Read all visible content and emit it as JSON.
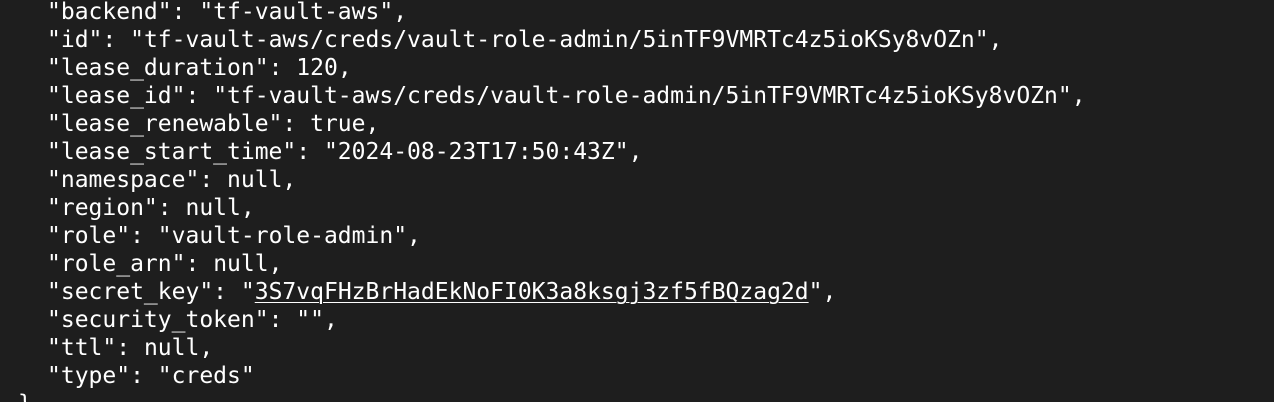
{
  "terminal": {
    "lines": [
      {
        "key": "\"backend\"",
        "sep": ": ",
        "value": "\"tf-vault-aws\"",
        "end": ","
      },
      {
        "key": "\"id\"",
        "sep": ": ",
        "value": "\"tf-vault-aws/creds/vault-role-admin/5inTF9VMRTc4z5ioKSy8vOZn\"",
        "end": ","
      },
      {
        "key": "\"lease_duration\"",
        "sep": ": ",
        "value": "120",
        "end": ","
      },
      {
        "key": "\"lease_id\"",
        "sep": ": ",
        "value": "\"tf-vault-aws/creds/vault-role-admin/5inTF9VMRTc4z5ioKSy8vOZn\"",
        "end": ","
      },
      {
        "key": "\"lease_renewable\"",
        "sep": ": ",
        "value": "true",
        "end": ","
      },
      {
        "key": "\"lease_start_time\"",
        "sep": ": ",
        "value": "\"2024-08-23T17:50:43Z\"",
        "end": ","
      },
      {
        "key": "\"namespace\"",
        "sep": ": ",
        "value": "null",
        "end": ","
      },
      {
        "key": "\"region\"",
        "sep": ": ",
        "value": "null",
        "end": ","
      },
      {
        "key": "\"role\"",
        "sep": ": ",
        "value": "\"vault-role-admin\"",
        "end": ","
      },
      {
        "key": "\"role_arn\"",
        "sep": ": ",
        "value": "null",
        "end": ","
      },
      {
        "key": "\"secret_key\"",
        "sep": ": ",
        "value_open": "\"",
        "value_link": "3S7vqFHzBrHadEkNoFI0K3a8ksgj3zf5fBQzag2d",
        "value_close": "\"",
        "end": ","
      },
      {
        "key": "\"security_token\"",
        "sep": ": ",
        "value": "\"\"",
        "end": ","
      },
      {
        "key": "\"ttl\"",
        "sep": ": ",
        "value": "null",
        "end": ","
      },
      {
        "key": "\"type\"",
        "sep": ": ",
        "value": "\"creds\"",
        "end": ""
      }
    ],
    "closing": "}"
  },
  "colors": {
    "background": "#1e1e1e",
    "text": "#ffffff"
  }
}
